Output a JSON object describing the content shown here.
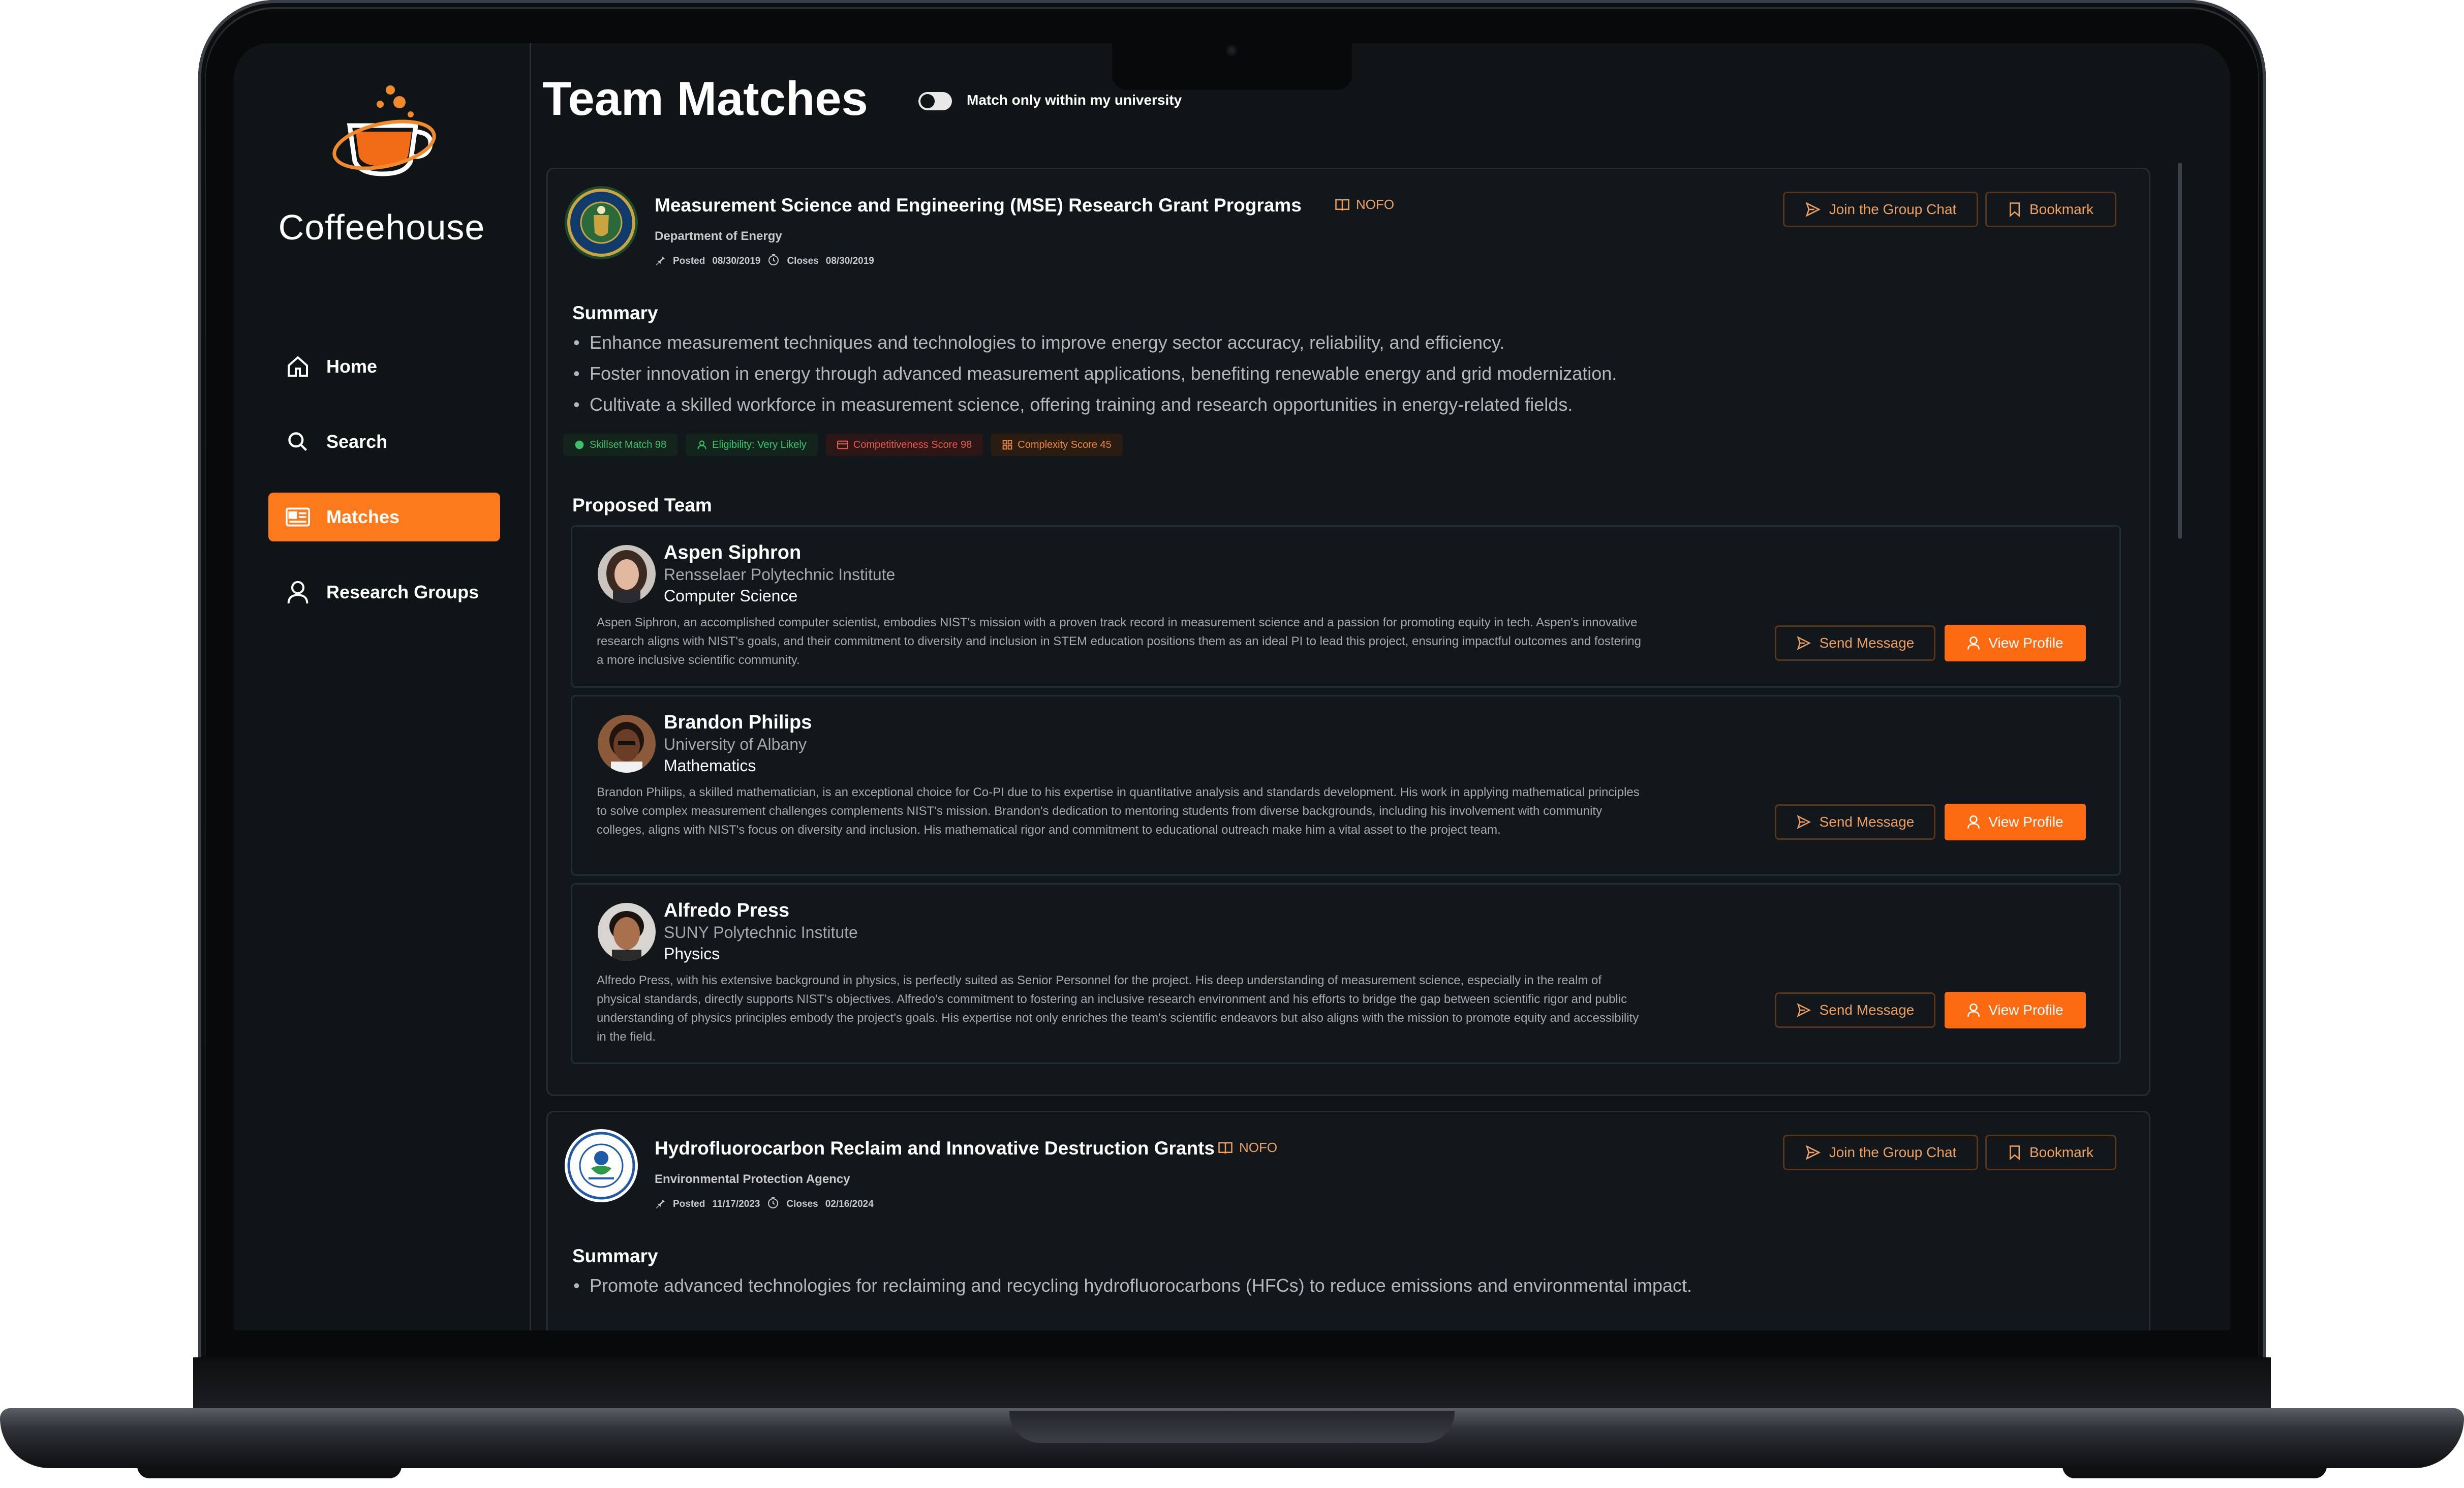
{
  "app": {
    "brand": "Coffeehouse",
    "accent_color": "#fc7a1c"
  },
  "sidebar": {
    "items": [
      {
        "label": "Home",
        "icon": "home-icon",
        "active": false
      },
      {
        "label": "Search",
        "icon": "search-icon",
        "active": false
      },
      {
        "label": "Matches",
        "icon": "matches-icon",
        "active": true
      },
      {
        "label": "Research Groups",
        "icon": "user-icon",
        "active": false
      }
    ]
  },
  "header": {
    "title": "Team Matches",
    "toggle_label": "Match only within my university",
    "toggle_on": false
  },
  "grants": [
    {
      "title": "Measurement Science and Engineering (MSE) Research Grant Programs",
      "nofo_label": "NOFO",
      "agency": "Department of Energy",
      "posted_label": "Posted",
      "posted_date": "08/30/2019",
      "closes_label": "Closes",
      "closes_date": "08/30/2019",
      "join_chat_label": "Join the Group Chat",
      "bookmark_label": "Bookmark",
      "summary_heading": "Summary",
      "summary": [
        "Enhance measurement techniques and technologies to improve energy sector accuracy, reliability, and efficiency.",
        "Foster innovation in energy through advanced measurement applications, benefiting renewable energy and grid modernization.",
        "Cultivate a skilled workforce in measurement science, offering training and research opportunities in energy-related fields."
      ],
      "tags": {
        "skillset": "Skillset Match 98",
        "eligibility": "Eligibility: Very Likely",
        "competitiveness": "Competitiveness Score 98",
        "complexity": "Complexity Score 45"
      },
      "team_heading": "Proposed Team",
      "team": [
        {
          "name": "Aspen Siphron",
          "institution": "Rensselaer Polytechnic Institute",
          "department": "Computer Science",
          "bio": "Aspen Siphron, an accomplished computer scientist, embodies NIST's mission with a proven track record in measurement science and a passion for promoting equity in tech. Aspen's innovative research aligns with NIST's goals, and their commitment to diversity and inclusion in STEM education positions them as an ideal PI to lead this project, ensuring impactful outcomes and fostering a more inclusive scientific community.",
          "send_label": "Send Message",
          "view_label": "View Profile"
        },
        {
          "name": "Brandon Philips",
          "institution": "University of Albany",
          "department": "Mathematics",
          "bio": "Brandon Philips, a skilled mathematician, is an exceptional choice for Co-PI due to his expertise in quantitative analysis and standards development. His work in applying mathematical principles to solve complex measurement challenges complements NIST's mission. Brandon's dedication to mentoring students from diverse backgrounds, including his involvement with community colleges, aligns with NIST's focus on diversity and inclusion. His mathematical rigor and commitment to educational outreach make him a vital asset to the project team.",
          "send_label": "Send Message",
          "view_label": "View Profile"
        },
        {
          "name": "Alfredo Press",
          "institution": "SUNY Polytechnic Institute",
          "department": "Physics",
          "bio": "Alfredo Press, with his extensive background in physics, is perfectly suited as Senior Personnel for the project. His deep understanding of measurement science, especially in the realm of physical standards, directly supports NIST's objectives. Alfredo's commitment to fostering an inclusive research environment and his efforts to bridge the gap between scientific rigor and public understanding of physics principles embody the project's goals. His expertise not only enriches the team's scientific endeavors but also aligns with the mission to promote equity and accessibility in the field.",
          "send_label": "Send Message",
          "view_label": "View Profile"
        }
      ]
    },
    {
      "title": "Hydrofluorocarbon Reclaim and Innovative Destruction Grants",
      "nofo_label": "NOFO",
      "agency": "Environmental Protection Agency",
      "posted_label": "Posted",
      "posted_date": "11/17/2023",
      "closes_label": "Closes",
      "closes_date": "02/16/2024",
      "join_chat_label": "Join the Group Chat",
      "bookmark_label": "Bookmark",
      "summary_heading": "Summary",
      "summary": [
        "Promote advanced technologies for reclaiming and recycling hydrofluorocarbons (HFCs) to reduce emissions and environmental impact."
      ]
    }
  ]
}
